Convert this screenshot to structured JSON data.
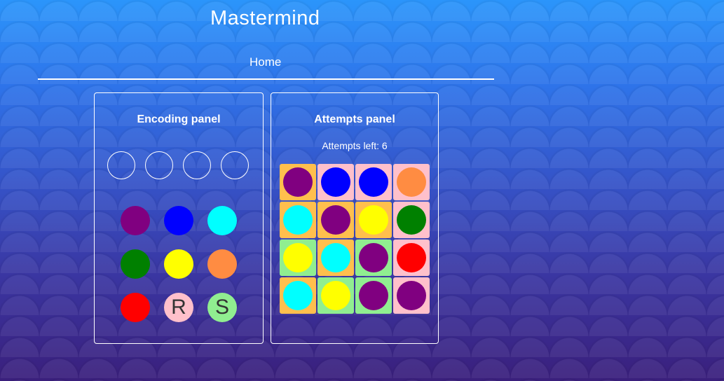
{
  "app": {
    "title": "Mastermind"
  },
  "nav": {
    "home_label": "Home"
  },
  "encoding_panel": {
    "title": "Encoding panel",
    "slots": [
      "",
      "",
      "",
      ""
    ],
    "palette": [
      {
        "name": "purple",
        "color": "#800080",
        "label": ""
      },
      {
        "name": "blue",
        "color": "#0000ff",
        "label": ""
      },
      {
        "name": "cyan",
        "color": "#00ffff",
        "label": ""
      },
      {
        "name": "green",
        "color": "#008000",
        "label": ""
      },
      {
        "name": "yellow",
        "color": "#ffff00",
        "label": ""
      },
      {
        "name": "orange",
        "color": "#ff8c42",
        "label": ""
      },
      {
        "name": "red",
        "color": "#ff0000",
        "label": ""
      },
      {
        "name": "reset",
        "color": "#ffc0cb",
        "label": "R"
      },
      {
        "name": "submit",
        "color": "#90ee90",
        "label": "S"
      }
    ]
  },
  "attempts_panel": {
    "title": "Attempts panel",
    "attempts_left": "Attempts left: 6",
    "feedback_colors": {
      "orange": "#ffbf4d",
      "pink": "#ffc0cb",
      "green": "#90ee90"
    },
    "rows": [
      [
        {
          "peg": "#800080",
          "feedback": "#ffbf4d"
        },
        {
          "peg": "#0000ff",
          "feedback": "#ffc0cb"
        },
        {
          "peg": "#0000ff",
          "feedback": "#ffc0cb"
        },
        {
          "peg": "#ff8c42",
          "feedback": "#ffc0cb"
        }
      ],
      [
        {
          "peg": "#00ffff",
          "feedback": "#ffbf4d"
        },
        {
          "peg": "#800080",
          "feedback": "#ffbf4d"
        },
        {
          "peg": "#ffff00",
          "feedback": "#ffbf4d"
        },
        {
          "peg": "#008000",
          "feedback": "#ffc0cb"
        }
      ],
      [
        {
          "peg": "#ffff00",
          "feedback": "#90ee90"
        },
        {
          "peg": "#00ffff",
          "feedback": "#ffbf4d"
        },
        {
          "peg": "#800080",
          "feedback": "#90ee90"
        },
        {
          "peg": "#ff0000",
          "feedback": "#ffc0cb"
        }
      ],
      [
        {
          "peg": "#00ffff",
          "feedback": "#ffbf4d"
        },
        {
          "peg": "#ffff00",
          "feedback": "#90ee90"
        },
        {
          "peg": "#800080",
          "feedback": "#90ee90"
        },
        {
          "peg": "#800080",
          "feedback": "#ffc0cb"
        }
      ]
    ]
  }
}
